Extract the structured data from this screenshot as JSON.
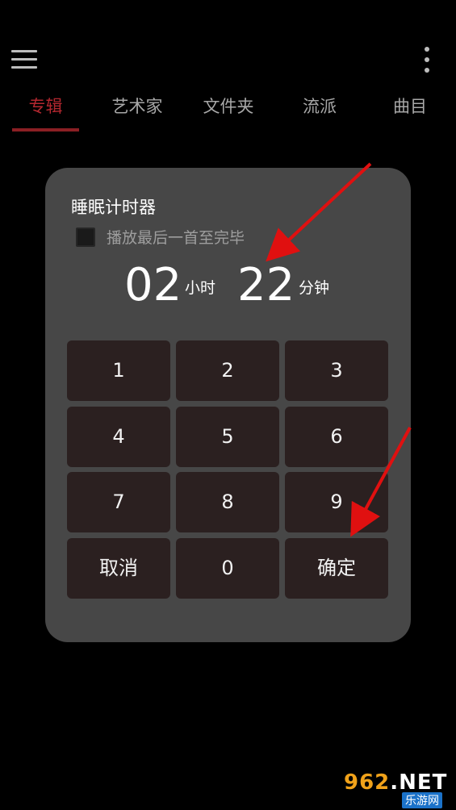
{
  "top_bar": {
    "menu_icon": "hamburger-menu-icon",
    "more_icon": "vertical-dots-more-icon"
  },
  "tabs": [
    {
      "label": "专辑",
      "active": true
    },
    {
      "label": "艺术家",
      "active": false
    },
    {
      "label": "文件夹",
      "active": false
    },
    {
      "label": "流派",
      "active": false
    },
    {
      "label": "曲目",
      "active": false
    }
  ],
  "colors": {
    "accent": "#b3272f",
    "dialog_bg": "#474747",
    "key_bg": "#2b2020",
    "arrow": "#e01010"
  },
  "dialog": {
    "title": "睡眠计时器",
    "checkbox_label": "播放最后一首至完毕",
    "checkbox_checked": false,
    "hours": "02",
    "hours_unit": "小时",
    "minutes": "22",
    "minutes_unit": "分钟",
    "keys": {
      "k1": "1",
      "k2": "2",
      "k3": "3",
      "k4": "4",
      "k5": "5",
      "k6": "6",
      "k7": "7",
      "k8": "8",
      "k9": "9",
      "cancel": "取消",
      "k0": "0",
      "confirm": "确定"
    }
  },
  "watermark": {
    "logo_text": "962.NET",
    "sub_text": "乐游网"
  }
}
